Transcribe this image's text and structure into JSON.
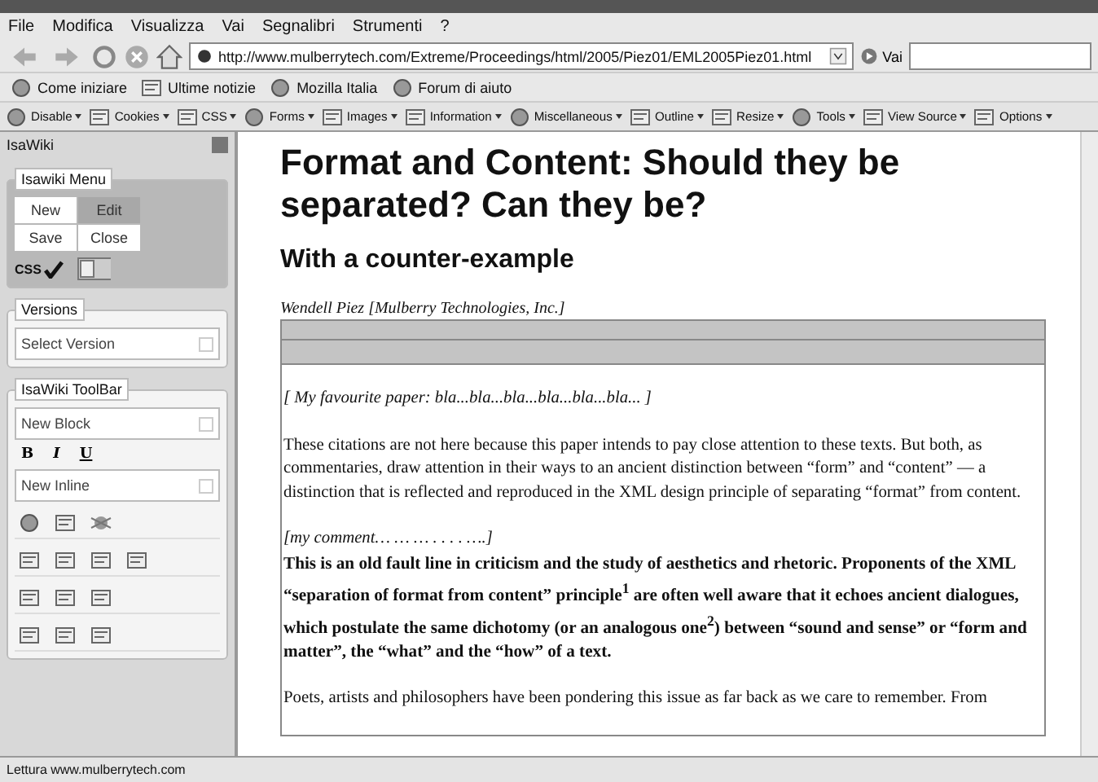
{
  "menu": [
    "File",
    "Modifica",
    "Visualizza",
    "Vai",
    "Segnalibri",
    "Strumenti",
    "?"
  ],
  "navigation": {
    "address": "http://www.mulberrytech.com/Extreme/Proceedings/html/2005/Piez01/EML2005Piez01.html",
    "go": "Vai"
  },
  "bookmarks": [
    "Come iniziare",
    "Ultime notizie",
    "Mozilla Italia",
    "Forum di aiuto"
  ],
  "dev_toolbar": [
    "Disable",
    "Cookies",
    "CSS",
    "Forms",
    "Images",
    "Information",
    "Miscellaneous",
    "Outline",
    "Resize",
    "Tools",
    "View Source",
    "Options"
  ],
  "sidebar": {
    "title": "IsaWiki",
    "menu": {
      "legend": "Isawiki Menu",
      "buttons": [
        {
          "label": "New",
          "disabled": false
        },
        {
          "label": "Edit",
          "disabled": true
        },
        {
          "label": "Save",
          "disabled": false
        },
        {
          "label": "Close",
          "disabled": false
        }
      ],
      "css_label": "CSS",
      "css_checked": true
    },
    "versions": {
      "legend": "Versions",
      "select": "Select Version"
    },
    "toolbar": {
      "legend": "IsaWiki ToolBar",
      "block_select": "New Block",
      "format_buttons": [
        "B",
        "I",
        "U"
      ],
      "inline_select": "New Inline"
    }
  },
  "article": {
    "title": "Format and Content: Should they be separated? Can they be?",
    "subtitle": "With a counter-example",
    "author": "Wendell Piez [Mulberry Technologies, Inc.]",
    "link": "[ My favourite paper: bla...bla...bla...bla...bla...bla... ]",
    "paragraphs": [
      {
        "kind": "plain",
        "text": "These citations are not here because this paper intends to pay close attention to these texts. But both, as commentaries, draw attention in their ways to an ancient distinction between “form” and “content” — a distinction that is reflected and reproduced in the XML design principle of separating “format” from content."
      },
      {
        "kind": "comment",
        "text": "[my comment… … … . . . . ….]"
      },
      {
        "kind": "bold",
        "text": "This is an old fault line in criticism and the study of aesthetics and rhetoric. Proponents of the XML “separation of format from content” principle$^{1}$ are often well aware that it echoes ancient dialogues, which postulate the same dichotomy (or an analogous one$^{2}$) between “sound and sense” or “form and matter”, the “what” and the “how” of a text."
      },
      {
        "kind": "plain",
        "text": "Poets, artists and philosophers have been pondering this issue as far back as we care to remember. From"
      }
    ]
  },
  "status_bar": "Lettura www.mulberrytech.com"
}
